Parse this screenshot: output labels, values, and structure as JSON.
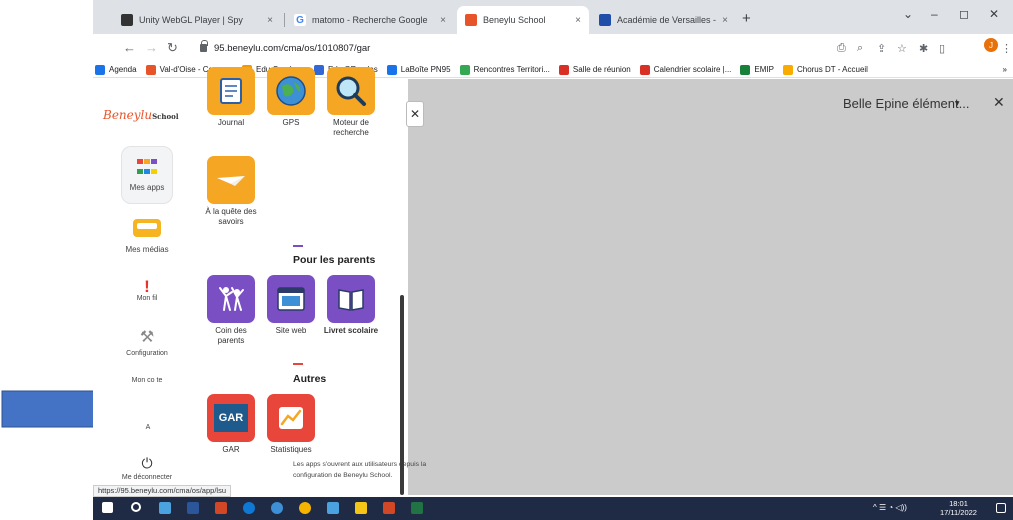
{
  "browser": {
    "tabs": [
      {
        "title": "Unity WebGL Player | Spy",
        "favicon_color": "#333333"
      },
      {
        "title": "matomo - Recherche Google",
        "favicon_color": "#4285f4",
        "favicon_char": "G"
      },
      {
        "title": "Beneylu School",
        "favicon_color": "#e8542a"
      },
      {
        "title": "Académie de Versailles - Messag",
        "favicon_color": "#1e4ea8"
      }
    ],
    "tab_close": "×",
    "new_tab": "+",
    "window_controls": [
      "⌄",
      "–",
      "◻",
      "✕"
    ],
    "url": "95.beneylu.com/cma/os/1010807/gar",
    "profile_initial": "J",
    "bookmarks": [
      {
        "label": "Agenda",
        "color": "#1a73e8"
      },
      {
        "label": "Val-d'Oise - Conne...",
        "color": "#e8542a"
      },
      {
        "label": "Edu-Sondage",
        "color": "#f29900"
      },
      {
        "label": "Edu QRcodes",
        "color": "#3367d6"
      },
      {
        "label": "LaBoîte PN95",
        "color": "#1a73e8"
      },
      {
        "label": "Rencontres Territori...",
        "color": "#34a853"
      },
      {
        "label": "Salle de réunion",
        "color": "#d93025"
      },
      {
        "label": "Calendrier scolaire |...",
        "color": "#d93025"
      },
      {
        "label": "EMIP",
        "color": "#188038"
      },
      {
        "label": "Chorus DT - Accueil",
        "color": "#f9ab00"
      }
    ],
    "bookmarks_more": "»",
    "status_url": "https://95.beneylu.com/cma/os/app/lsu"
  },
  "sidebar": {
    "logo": "Beneylu",
    "logo_sub": "School",
    "items": [
      {
        "label": "Mes apps"
      },
      {
        "label": "Mes médias"
      },
      {
        "label": "Mon fil"
      },
      {
        "label": "Configuration"
      },
      {
        "label": "Mon co      te"
      },
      {
        "label": "A"
      },
      {
        "label": "Me déconnecter"
      }
    ]
  },
  "panel": {
    "top_apps": [
      {
        "label": "Journal"
      },
      {
        "label": "GPS"
      },
      {
        "label": "Moteur de recherche"
      },
      {
        "label": "À la quête des savoirs"
      }
    ],
    "sections": [
      {
        "title": "Pour les parents",
        "bar_color": "#7b4fc4",
        "apps": [
          {
            "label": "Coin des parents"
          },
          {
            "label": "Site web"
          },
          {
            "label": "Livret scolaire"
          }
        ]
      },
      {
        "title": "Autres",
        "bar_color": "#e8463b",
        "apps": [
          {
            "label": "GAR",
            "tile_text": "GAR"
          },
          {
            "label": "Statistiques"
          }
        ]
      }
    ],
    "footnote": "Les apps s'ouvrent aux utilisateurs depuis la configuration de Beneylu School."
  },
  "right_panel": {
    "title": "Belle Epine élément...",
    "caret": "▾",
    "close": "✕"
  },
  "panel_close": "✕",
  "taskbar": {
    "time": "18:01",
    "date": "17/11/2022",
    "tray": "^ ☰ ◔ ◁))"
  },
  "colors": {
    "accent_orange": "#f5a623",
    "accent_purple": "#7b4fc4",
    "accent_red": "#e8463b",
    "arrow_blue": "#4472c4",
    "gar_blue": "#1f5a8c"
  }
}
